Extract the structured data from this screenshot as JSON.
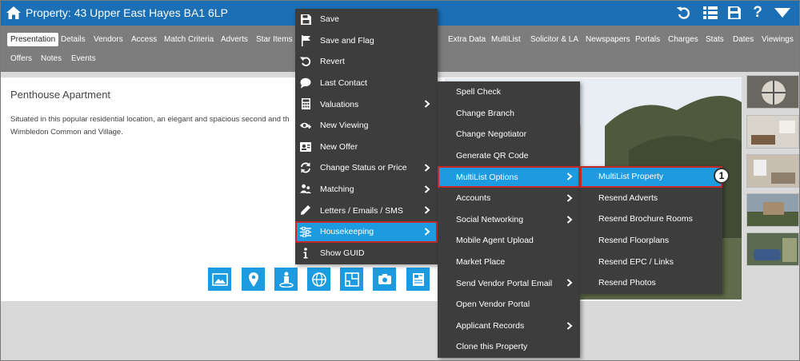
{
  "header": {
    "title": "Property: 43 Upper East Hayes BA1 6LP",
    "icons": [
      "home-icon",
      "undo-icon",
      "list-icon",
      "save-icon",
      "help-icon",
      "dropdown-icon"
    ],
    "help_glyph": "?",
    "accent": "#1a6fb5"
  },
  "tabs": {
    "row1": [
      {
        "label": "Presentation",
        "active": true
      },
      {
        "label": "Details"
      },
      {
        "label": "Vendors"
      },
      {
        "label": "Access"
      },
      {
        "label": "Match Criteria"
      },
      {
        "label": "Adverts"
      },
      {
        "label": "Star Items"
      },
      {
        "label": "Extra Data"
      },
      {
        "label": "MultiList"
      },
      {
        "label": "Solicitor & LA"
      },
      {
        "label": "Newspapers"
      },
      {
        "label": "Portals"
      },
      {
        "label": "Charges"
      },
      {
        "label": "Stats"
      },
      {
        "label": "Dates"
      },
      {
        "label": "Viewings"
      }
    ],
    "row2": [
      {
        "label": "Offers"
      },
      {
        "label": "Notes"
      },
      {
        "label": "Events"
      }
    ]
  },
  "content": {
    "heading": "Penthouse Apartment",
    "description_line1": "Situated in this popular residential location, an elegant and spacious second and th",
    "description_line2": "Wimbledon Common and Village.",
    "tool_icons": [
      "image-icon",
      "map-pin-icon",
      "street-view-icon",
      "globe-icon",
      "floorplan-icon",
      "camera-360-icon",
      "brochure-icon"
    ]
  },
  "menu1": {
    "items": [
      {
        "label": "Save",
        "icon": "floppy-icon"
      },
      {
        "label": "Save and Flag",
        "icon": "flag-icon"
      },
      {
        "label": "Revert",
        "icon": "revert-icon"
      },
      {
        "label": "Last Contact",
        "icon": "speech-bubble-icon"
      },
      {
        "label": "Valuations",
        "icon": "calculator-icon",
        "submenu": true
      },
      {
        "label": "New Viewing",
        "icon": "eye-plus-icon"
      },
      {
        "label": "New Offer",
        "icon": "offer-icon"
      },
      {
        "label": "Change Status or Price",
        "icon": "refresh-icon",
        "submenu": true
      },
      {
        "label": "Matching",
        "icon": "people-icon",
        "submenu": true
      },
      {
        "label": "Letters / Emails / SMS",
        "icon": "pencil-icon",
        "submenu": true
      },
      {
        "label": "Housekeeping",
        "icon": "sliders-icon",
        "submenu": true,
        "highlighted": true
      },
      {
        "label": "Show GUID",
        "icon": "info-icon"
      }
    ]
  },
  "menu2": {
    "items": [
      {
        "label": "Spell Check"
      },
      {
        "label": "Change Branch"
      },
      {
        "label": "Change Negotiator"
      },
      {
        "label": "Generate QR Code"
      },
      {
        "label": "MultiList Options",
        "submenu": true,
        "highlighted": true
      },
      {
        "label": "Accounts",
        "submenu": true
      },
      {
        "label": "Social Networking",
        "submenu": true
      },
      {
        "label": "Mobile Agent Upload"
      },
      {
        "label": "Market Place"
      },
      {
        "label": "Send Vendor Portal Email",
        "submenu": true
      },
      {
        "label": "Open Vendor Portal"
      },
      {
        "label": "Applicant Records",
        "submenu": true
      },
      {
        "label": "Clone this Property"
      }
    ]
  },
  "menu3": {
    "items": [
      {
        "label": "MultiList Property",
        "highlighted": true
      },
      {
        "label": "Resend Adverts"
      },
      {
        "label": "Resend Brochure Rooms"
      },
      {
        "label": "Resend Floorplans"
      },
      {
        "label": "Resend EPC / Links"
      },
      {
        "label": "Resend Photos"
      }
    ]
  },
  "callout": {
    "number": "1"
  },
  "colors": {
    "menu_bg": "#3d3d3d",
    "highlight": "#1d9be0",
    "highlight_border": "#c62828",
    "tab_bar": "#7d7d7d"
  }
}
